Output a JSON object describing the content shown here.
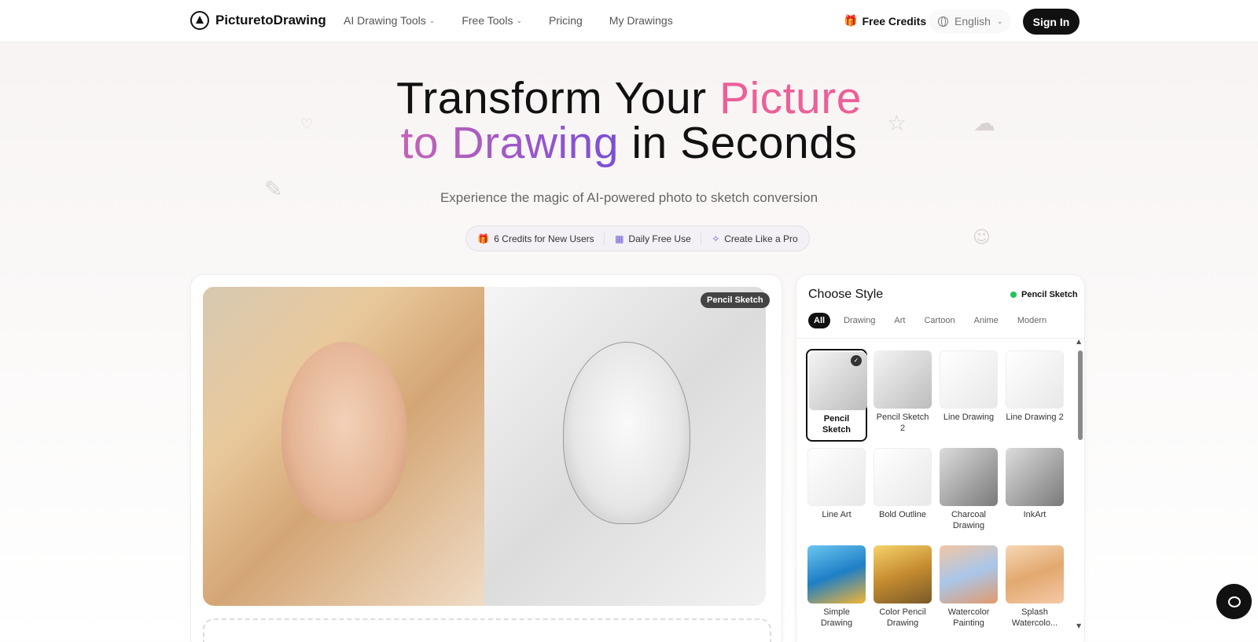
{
  "header": {
    "logo_text": "PicturetoDrawing",
    "nav": [
      {
        "label": "AI Drawing Tools",
        "has_chevron": true
      },
      {
        "label": "Free Tools",
        "has_chevron": true
      },
      {
        "label": "Pricing",
        "has_chevron": false
      },
      {
        "label": "My Drawings",
        "has_chevron": false
      }
    ],
    "free_credits_label": "Free Credits",
    "language": "English",
    "signin_label": "Sign In"
  },
  "hero": {
    "title_part1": "Transform Your ",
    "title_highlight1": "Picture",
    "title_highlight2": "to Drawing",
    "title_part2": " in Seconds",
    "subtitle": "Experience the magic of AI-powered photo to sketch conversion",
    "pills": [
      {
        "icon": "gift-icon",
        "label": "6 Credits for New Users"
      },
      {
        "icon": "calendar-icon",
        "label": "Daily Free Use"
      },
      {
        "icon": "sparkle-icon",
        "label": "Create Like a Pro"
      }
    ]
  },
  "compare": {
    "result_badge": "Pencil Sketch"
  },
  "style_panel": {
    "title": "Choose Style",
    "current_style": "Pencil Sketch",
    "filters": [
      "All",
      "Drawing",
      "Art",
      "Cartoon",
      "Anime",
      "Modern"
    ],
    "active_filter": "All",
    "styles": [
      {
        "label": "Pencil Sketch",
        "selected": true
      },
      {
        "label": "Pencil Sketch 2",
        "selected": false
      },
      {
        "label": "Line Drawing",
        "selected": false
      },
      {
        "label": "Line Drawing 2",
        "selected": false
      },
      {
        "label": "Line Art",
        "selected": false
      },
      {
        "label": "Bold Outline",
        "selected": false
      },
      {
        "label": "Charcoal Drawing",
        "selected": false
      },
      {
        "label": "InkArt",
        "selected": false
      },
      {
        "label": "Simple Drawing",
        "selected": false
      },
      {
        "label": "Color Pencil Drawing",
        "selected": false
      },
      {
        "label": "Watercolor Painting",
        "selected": false
      },
      {
        "label": "Splash Watercolo...",
        "selected": false
      }
    ]
  },
  "colors": {
    "accent_pink": "#ec5f98",
    "accent_purple": "#7a4fd6",
    "primary_dark": "#111111",
    "status_green": "#21c45d"
  }
}
